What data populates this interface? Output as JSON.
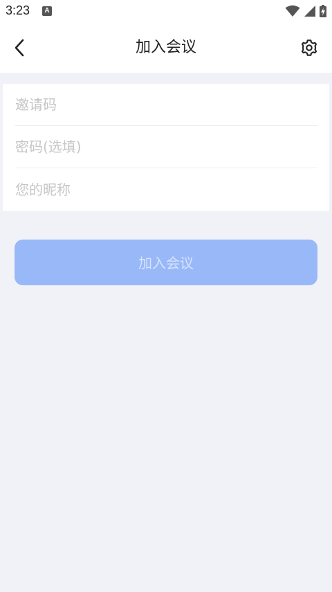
{
  "status_bar": {
    "time": "3:23",
    "notification_glyph": "A",
    "icons": [
      "wifi-icon",
      "signal-icon",
      "battery-charging-icon"
    ]
  },
  "header": {
    "title": "加入会议",
    "back_icon": "chevron-left-icon",
    "settings_icon": "gear-icon"
  },
  "form": {
    "invite_code_placeholder": "邀请码",
    "password_placeholder": "密码(选填)",
    "nickname_placeholder": "您的昵称"
  },
  "join_button_label": "加入会议",
  "colors": {
    "background": "#f0f2f8",
    "button_disabled": "#98b8f8",
    "button_text_disabled": "#d8e4fb",
    "placeholder": "#c6c6c6"
  }
}
